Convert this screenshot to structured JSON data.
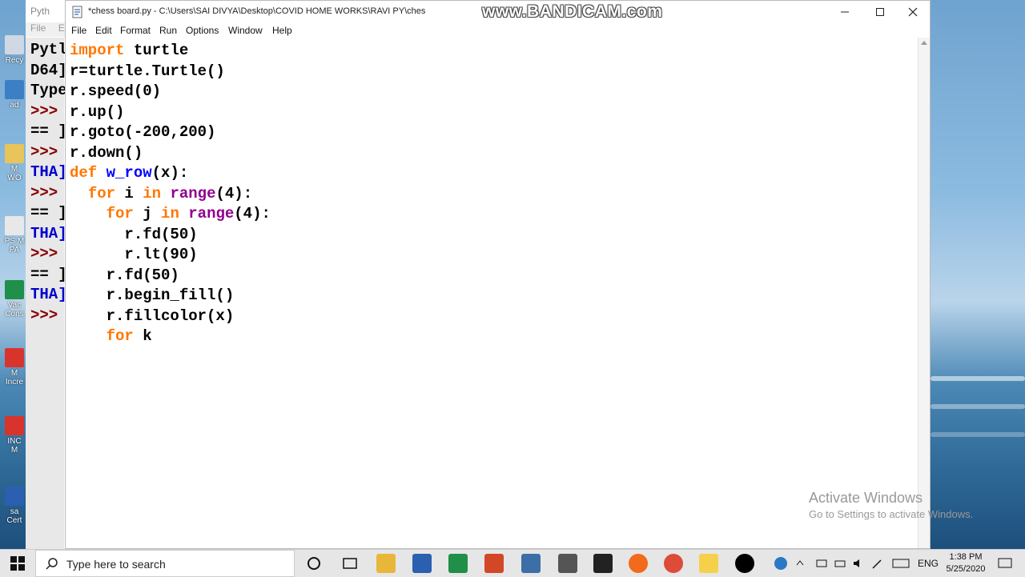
{
  "shell": {
    "title": "Pyth",
    "menu": [
      "File",
      "Ed"
    ],
    "lines": [
      {
        "text": "Pytl",
        "color": "black"
      },
      {
        "text": "D64]",
        "color": "black"
      },
      {
        "text": "Type",
        "color": "black"
      },
      {
        "text": ">>> ",
        "color": "prompt"
      },
      {
        "text": "== ]",
        "color": "black"
      },
      {
        "text": ">>> ",
        "color": "prompt"
      },
      {
        "text": "THA]",
        "color": "blue"
      },
      {
        "text": ">>> ",
        "color": "prompt"
      },
      {
        "text": "== ]",
        "color": "black"
      },
      {
        "text": "THA]",
        "color": "blue"
      },
      {
        "text": ">>> ",
        "color": "prompt"
      },
      {
        "text": "== ]",
        "color": "black"
      },
      {
        "text": "THA]",
        "color": "blue"
      },
      {
        "text": ">>> ",
        "color": "prompt"
      }
    ]
  },
  "editor": {
    "title": "*chess board.py - C:\\Users\\SAI DIVYA\\Desktop\\COVID HOME WORKS\\RAVI PY\\ches",
    "watermark": "www.BANDICAM.com",
    "menu": [
      "File",
      "Edit",
      "Format",
      "Run",
      "Options",
      "Window",
      "Help"
    ],
    "code": [
      [
        {
          "t": "import",
          "c": "kw"
        },
        {
          "t": " turtle",
          "c": ""
        }
      ],
      [
        {
          "t": "r=turtle.Turtle()",
          "c": ""
        }
      ],
      [
        {
          "t": "r.speed(0)",
          "c": ""
        }
      ],
      [
        {
          "t": "r.up()",
          "c": ""
        }
      ],
      [
        {
          "t": "r.goto(-200,200)",
          "c": ""
        }
      ],
      [
        {
          "t": "r.down()",
          "c": ""
        }
      ],
      [
        {
          "t": "def",
          "c": "kw"
        },
        {
          "t": " ",
          "c": ""
        },
        {
          "t": "w_row",
          "c": "fn"
        },
        {
          "t": "(x):",
          "c": ""
        }
      ],
      [
        {
          "t": "  ",
          "c": ""
        },
        {
          "t": "for",
          "c": "kw"
        },
        {
          "t": " i ",
          "c": ""
        },
        {
          "t": "in",
          "c": "kw"
        },
        {
          "t": " ",
          "c": ""
        },
        {
          "t": "range",
          "c": "bi"
        },
        {
          "t": "(4):",
          "c": ""
        }
      ],
      [
        {
          "t": "    ",
          "c": ""
        },
        {
          "t": "for",
          "c": "kw"
        },
        {
          "t": " j ",
          "c": ""
        },
        {
          "t": "in",
          "c": "kw"
        },
        {
          "t": " ",
          "c": ""
        },
        {
          "t": "range",
          "c": "bi"
        },
        {
          "t": "(4):",
          "c": ""
        }
      ],
      [
        {
          "t": "      r.fd(50)",
          "c": ""
        }
      ],
      [
        {
          "t": "      r.lt(90)",
          "c": ""
        }
      ],
      [
        {
          "t": "    r.fd(50)",
          "c": ""
        }
      ],
      [
        {
          "t": "    r.begin_fill()",
          "c": ""
        }
      ],
      [
        {
          "t": "    r.fillcolor(x)",
          "c": ""
        }
      ],
      [
        {
          "t": "    ",
          "c": ""
        },
        {
          "t": "for",
          "c": "kw"
        },
        {
          "t": " k",
          "c": ""
        }
      ]
    ]
  },
  "activation": {
    "line1": "Activate Windows",
    "line2": "Go to Settings to activate Windows."
  },
  "taskbar": {
    "search_placeholder": "Type here to search",
    "language": "ENG",
    "time": "1:38 PM",
    "date": "5/25/2020"
  },
  "desktop": {
    "icons": [
      "Recy",
      "ad",
      "M WO",
      "PS M PA",
      "Vac Cons",
      "M Incre",
      "INC M",
      "sa Cert"
    ]
  },
  "colors": {
    "keyword": "#ff7700",
    "builtin": "#900090",
    "definition": "#0000ff",
    "shell_prompt": "#800000",
    "shell_blue": "#0000cc"
  }
}
